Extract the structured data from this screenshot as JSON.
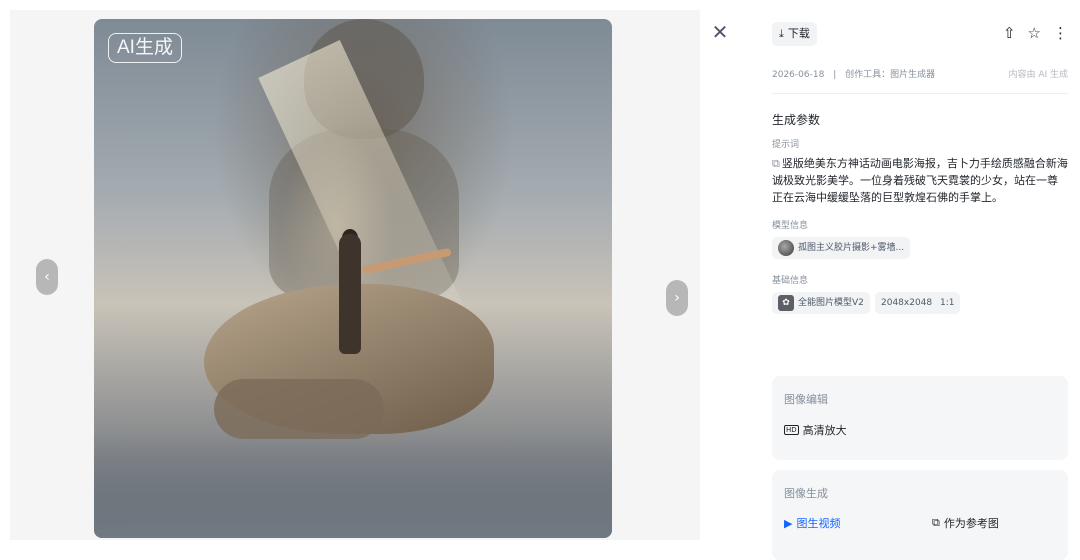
{
  "viewer": {
    "badge": "AI生成",
    "prev_glyph": "‹",
    "next_glyph": "›",
    "close_glyph": "✕"
  },
  "panel": {
    "download_label": "下载",
    "download_icon_glyph": "⤓",
    "share_glyph": "⇧",
    "star_glyph": "☆",
    "more_glyph": "⋮",
    "date": "2026-06-18",
    "separator": "|",
    "tool_text": "创作工具：图片生成器",
    "ai_note": "内容由 AI 生成",
    "section_title": "生成参数",
    "prompt_label": "提示词",
    "prompt_text": "竖版绝美东方神话动画电影海报，吉卜力手绘质感融合新海诚极致光影美学。一位身着残破飞天霓裳的少女，站在一尊正在云海中缓缓坠落的巨型敦煌石佛的手掌上。",
    "model_label": "模型信息",
    "model_style": "孤图主义胶片摄影+雾墙...",
    "basic_label": "基础信息",
    "model_name": "全能图片模型V2",
    "resolution": "2048x2048",
    "ratio": "1:1",
    "edit_card": {
      "title": "图像编辑",
      "action": "高清放大",
      "action_icon": "HD"
    },
    "gen_card": {
      "title": "图像生成",
      "action1": "图生视频",
      "action1_icon": "▶",
      "action2": "作为参考图",
      "action2_icon": "⧉"
    }
  },
  "colors": {
    "accent": "#1664ff",
    "muted_text": "#86909c",
    "chip_bg": "#f2f3f5"
  }
}
